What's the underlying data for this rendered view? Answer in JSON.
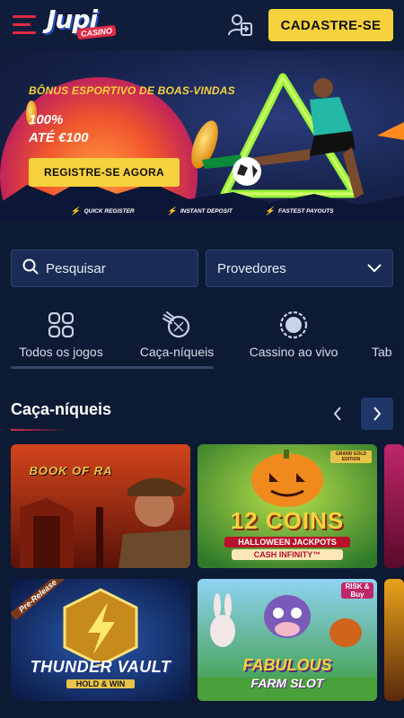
{
  "header": {
    "logo_text": "Jupi",
    "logo_sub": "CASINO",
    "signup_label": "CADASTRE-SE"
  },
  "banner": {
    "title": "BÔNUS ESPORTIVO DE BOAS-VINDAS",
    "amount_line1": "100%",
    "amount_line2": "ATÉ €100",
    "cta_label": "REGISTRE-SE AGORA",
    "features": [
      "QUICK REGISTER",
      "INSTANT DEPOSIT",
      "FASTEST PAYOUTS"
    ]
  },
  "search": {
    "placeholder": "Pesquisar"
  },
  "providers": {
    "label": "Provedores"
  },
  "tabs": [
    {
      "label": "Todos os jogos",
      "icon": "grid-icon"
    },
    {
      "label": "Caça-níqueis",
      "icon": "slot-ball-icon"
    },
    {
      "label": "Cassino ao vivo",
      "icon": "roulette-icon"
    },
    {
      "label": "Tab",
      "icon": ""
    }
  ],
  "section": {
    "title": "Caça-níqueis"
  },
  "games": [
    {
      "title": "BOOK OF RA",
      "subtitle": ""
    },
    {
      "title": "12 COINS",
      "subtitle": "HALLOWEEN JACKPOTS",
      "tag": "CASH INFINITY™",
      "badge": "GRAND GOLD EDITION"
    },
    {
      "title": "THUNDER VAULT",
      "subtitle": "HOLD & WIN",
      "badge": "Pre-Release"
    },
    {
      "title": "FABULOUS",
      "subtitle": "FARM SLOT",
      "badge": "RISK & Buy"
    }
  ],
  "colors": {
    "background": "#0d1a33",
    "accent_yellow": "#f8d23c",
    "accent_red": "#e02a44",
    "field_bg": "#1a2c55"
  }
}
